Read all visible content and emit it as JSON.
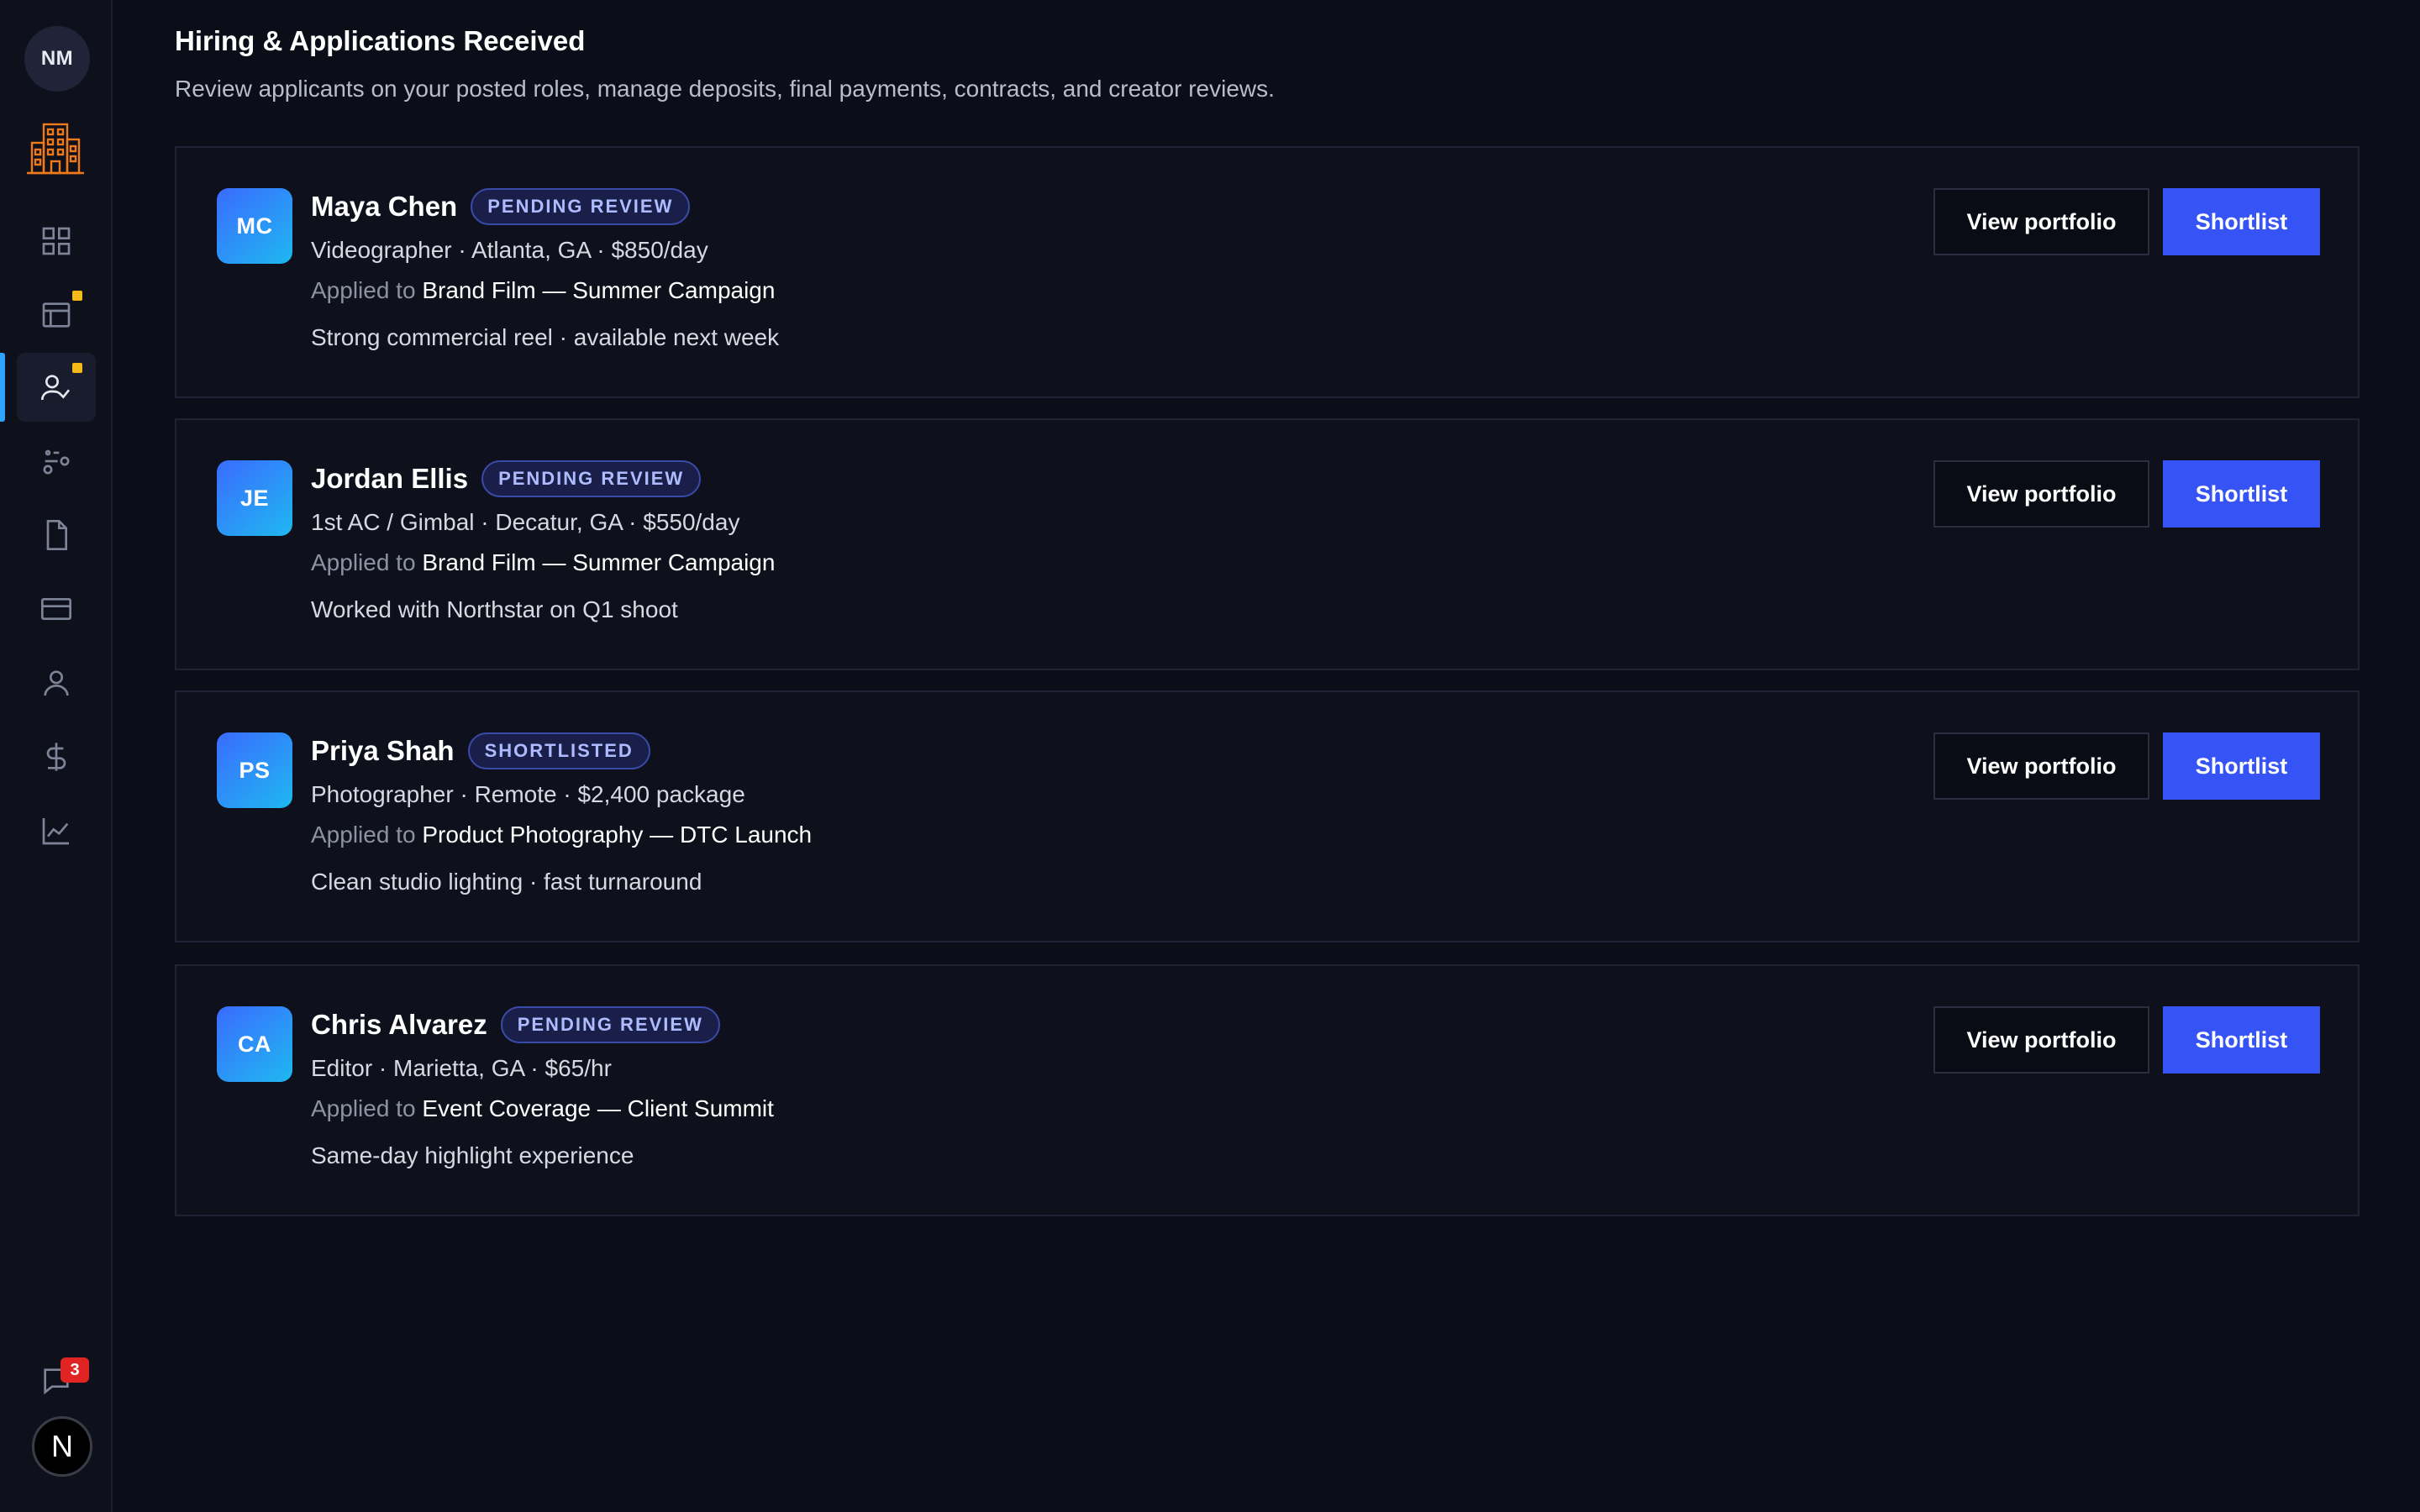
{
  "sidebar": {
    "user_initials": "NM",
    "message_count": "3",
    "bottom_avatar_letter": "N",
    "nav": [
      {
        "icon": "dashboard-grid-icon",
        "dot": false
      },
      {
        "icon": "calendar-window-icon",
        "dot": true
      },
      {
        "icon": "user-check-icon",
        "dot": true,
        "active": true
      },
      {
        "icon": "workflow-icon",
        "dot": false
      },
      {
        "icon": "document-icon",
        "dot": false
      },
      {
        "icon": "credit-card-icon",
        "dot": false
      },
      {
        "icon": "user-icon",
        "dot": false
      },
      {
        "icon": "dollar-icon",
        "dot": false
      },
      {
        "icon": "chart-line-icon",
        "dot": false
      }
    ],
    "colors": {
      "active_indicator": "#2fa3ff",
      "dot": "#f5b917",
      "badge": "#e02424",
      "logo": "#f07a1a"
    }
  },
  "page": {
    "title": "Hiring & Applications Received",
    "subtitle": "Review applicants on your posted roles, manage deposits, final payments, contracts, and creator reviews."
  },
  "applicants": [
    {
      "initials": "MC",
      "name": "Maya Chen",
      "status": "PENDING REVIEW",
      "meta": "Videographer · Atlanta, GA · $850/day",
      "applied_label": "Applied to",
      "project": "Brand Film — Summer Campaign",
      "note": "Strong commercial reel · available next week",
      "portfolio_label": "View portfolio",
      "shortlist_label": "Shortlist"
    },
    {
      "initials": "JE",
      "name": "Jordan Ellis",
      "status": "PENDING REVIEW",
      "meta": "1st AC / Gimbal · Decatur, GA · $550/day",
      "applied_label": "Applied to",
      "project": "Brand Film — Summer Campaign",
      "note": "Worked with Northstar on Q1 shoot",
      "portfolio_label": "View portfolio",
      "shortlist_label": "Shortlist"
    },
    {
      "initials": "PS",
      "name": "Priya Shah",
      "status": "SHORTLISTED",
      "meta": "Photographer · Remote · $2,400 package",
      "applied_label": "Applied to",
      "project": "Product Photography — DTC Launch",
      "note": "Clean studio lighting · fast turnaround",
      "portfolio_label": "View portfolio",
      "shortlist_label": "Shortlist"
    },
    {
      "initials": "CA",
      "name": "Chris Alvarez",
      "status": "PENDING REVIEW",
      "meta": "Editor · Marietta, GA · $65/hr",
      "applied_label": "Applied to",
      "project": "Event Coverage — Client Summit",
      "note": "Same-day highlight experience",
      "portfolio_label": "View portfolio",
      "shortlist_label": "Shortlist"
    }
  ],
  "colors": {
    "background": "#0b0d18",
    "card": "#0e111c",
    "primary_button": "#3654f5",
    "badge_text": "#aebcff"
  }
}
